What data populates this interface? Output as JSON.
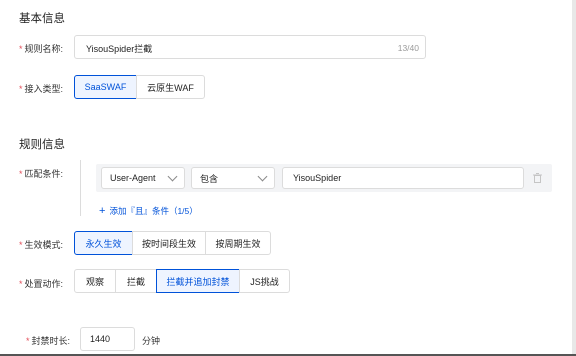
{
  "basic": {
    "title": "基本信息",
    "rule_name_label": "规则名称:",
    "rule_name_value": "YisouSpider拦截",
    "rule_name_counter": "13/40",
    "access_type_label": "接入类型:",
    "access_types": [
      "SaaSWAF",
      "云原生WAF"
    ]
  },
  "rule": {
    "title": "规则信息",
    "match_label": "匹配条件:",
    "condition": {
      "field": "User-Agent",
      "operator": "包含",
      "value": "YisouSpider"
    },
    "add_condition": "添加『且』条件（1/5）",
    "effect_label": "生效模式:",
    "effect_modes": [
      "永久生效",
      "按时间段生效",
      "按周期生效"
    ],
    "action_label": "处置动作:",
    "actions": [
      "观察",
      "拦截",
      "拦截并追加封禁",
      "JS挑战"
    ],
    "ban_label": "封禁时长:",
    "ban_value": "1440",
    "ban_unit": "分钟"
  }
}
